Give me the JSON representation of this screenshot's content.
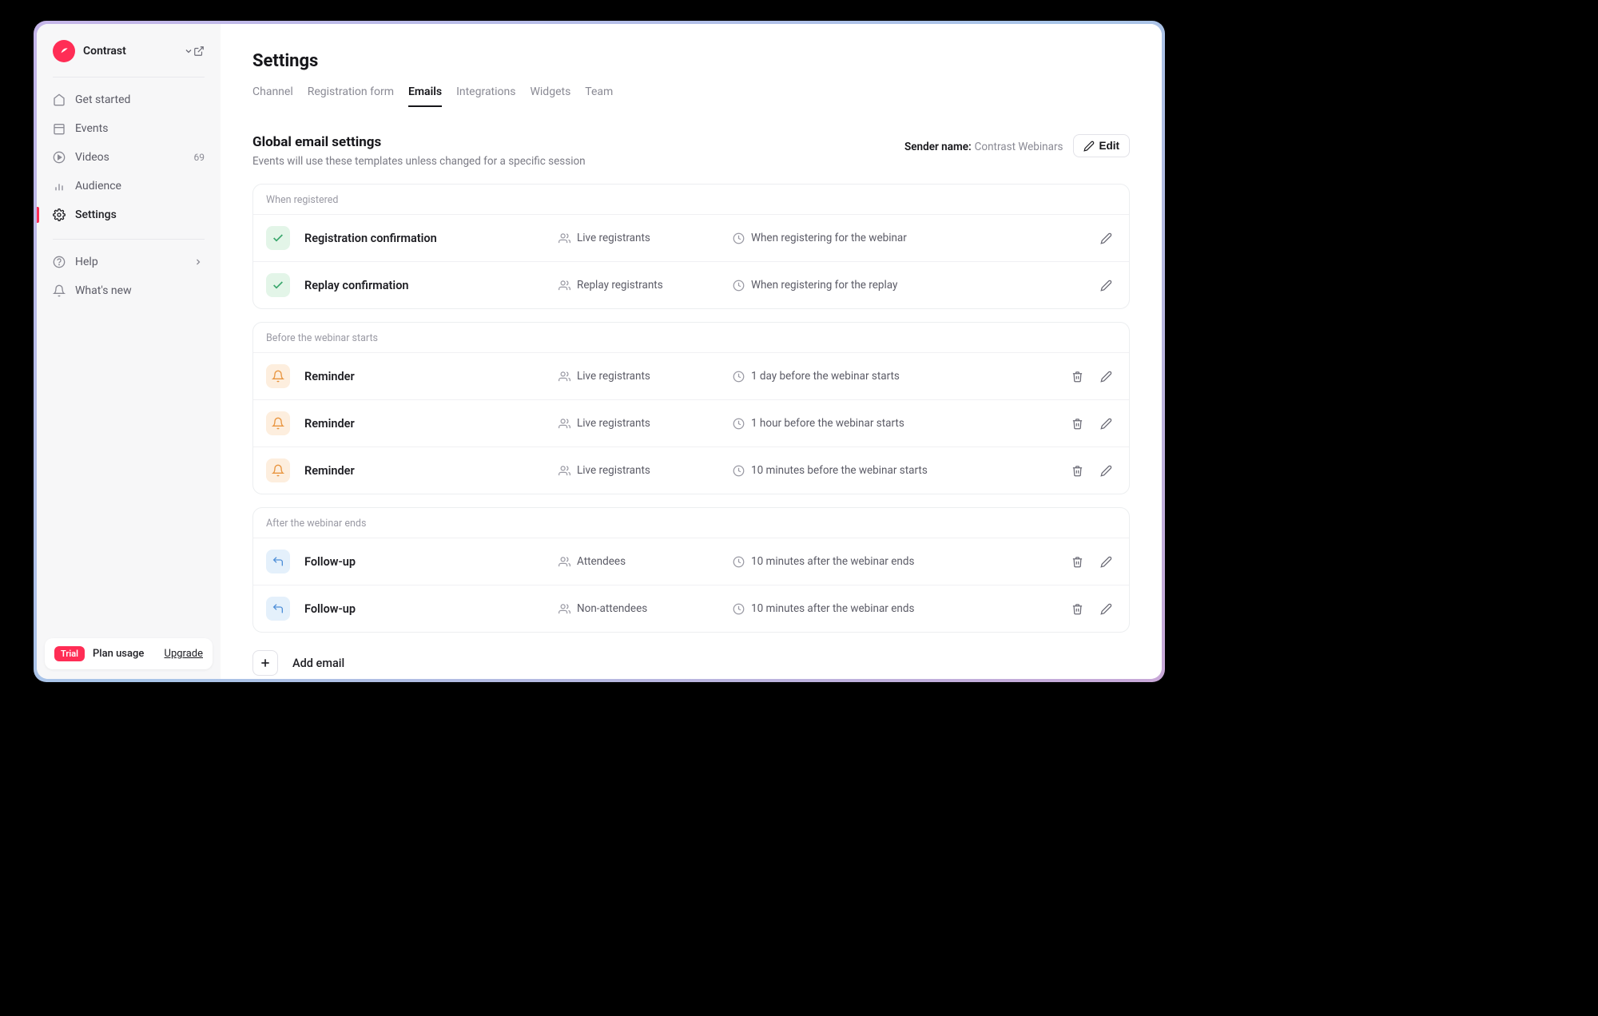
{
  "org": {
    "name": "Contrast"
  },
  "sidebar": {
    "items": [
      {
        "label": "Get started"
      },
      {
        "label": "Events"
      },
      {
        "label": "Videos",
        "count": "69"
      },
      {
        "label": "Audience"
      },
      {
        "label": "Settings"
      },
      {
        "label": "Help"
      },
      {
        "label": "What's new"
      }
    ]
  },
  "plan": {
    "badge": "Trial",
    "label": "Plan usage",
    "upgrade": "Upgrade"
  },
  "page": {
    "title": "Settings",
    "tabs": [
      "Channel",
      "Registration form",
      "Emails",
      "Integrations",
      "Widgets",
      "Team"
    ],
    "section_title": "Global email settings",
    "section_desc": "Events will use these templates unless changed for a specific session",
    "sender_label": "Sender name:",
    "sender_value": "Contrast Webinars",
    "edit_label": "Edit",
    "add_label": "Add email"
  },
  "groups": [
    {
      "title": "When registered",
      "rows": [
        {
          "icon": "green",
          "name": "Registration confirmation",
          "audience": "Live registrants",
          "when": "When registering for the webinar",
          "deletable": false
        },
        {
          "icon": "green",
          "name": "Replay confirmation",
          "audience": "Replay registrants",
          "when": "When registering for the replay",
          "deletable": false
        }
      ]
    },
    {
      "title": "Before the webinar starts",
      "rows": [
        {
          "icon": "orange",
          "name": "Reminder",
          "audience": "Live registrants",
          "when": "1 day before the webinar starts",
          "deletable": true
        },
        {
          "icon": "orange",
          "name": "Reminder",
          "audience": "Live registrants",
          "when": "1 hour before the webinar starts",
          "deletable": true
        },
        {
          "icon": "orange",
          "name": "Reminder",
          "audience": "Live registrants",
          "when": "10 minutes before the webinar starts",
          "deletable": true
        }
      ]
    },
    {
      "title": "After the webinar ends",
      "rows": [
        {
          "icon": "blue",
          "name": "Follow-up",
          "audience": "Attendees",
          "when": "10 minutes after the webinar ends",
          "deletable": true
        },
        {
          "icon": "blue",
          "name": "Follow-up",
          "audience": "Non-attendees",
          "when": "10 minutes after the webinar ends",
          "deletable": true
        }
      ]
    }
  ]
}
